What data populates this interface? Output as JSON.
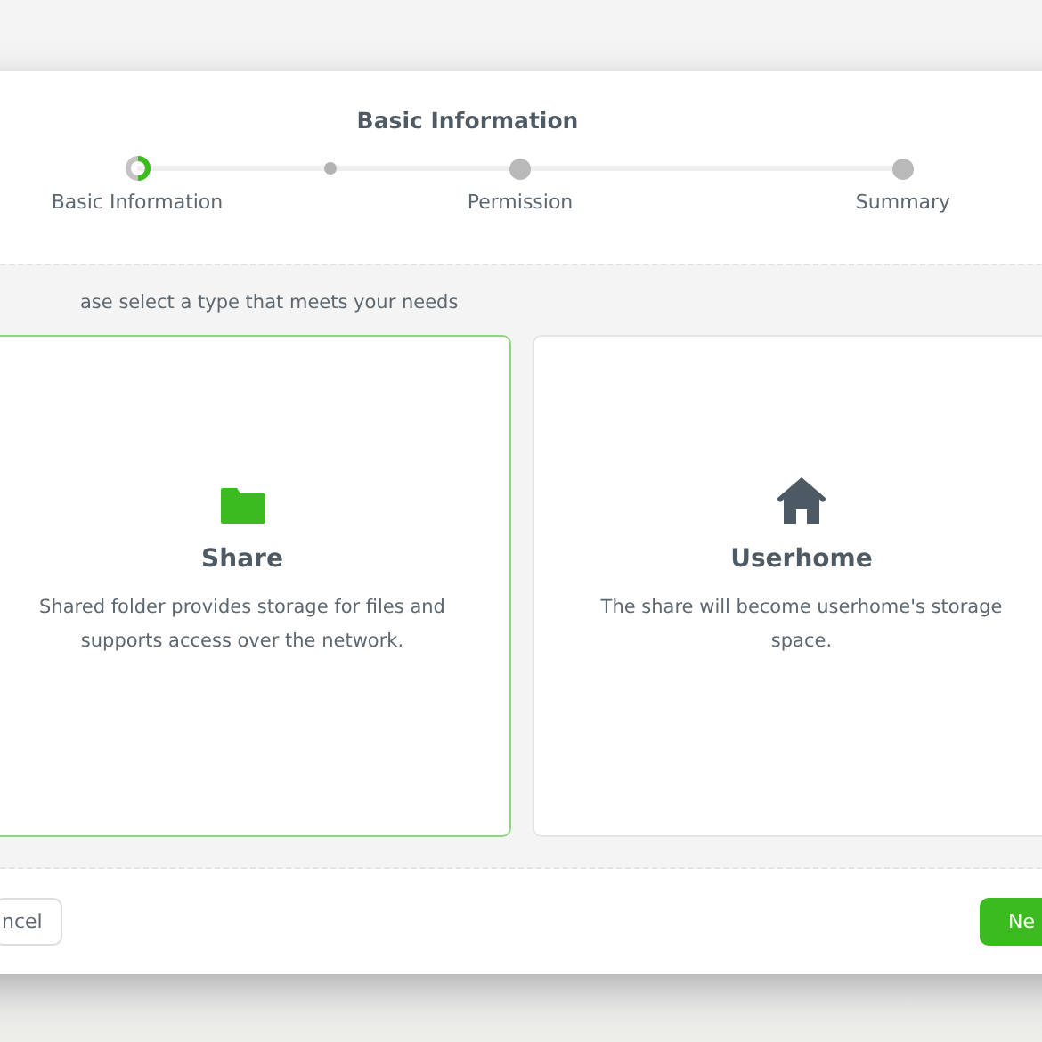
{
  "dialog": {
    "title": "Basic Information",
    "steps": [
      {
        "label": "Basic Information",
        "current": true
      },
      {
        "label": "Permission",
        "current": false
      },
      {
        "label": "Summary",
        "current": false
      }
    ],
    "instruction": "ase select a type that meets your needs",
    "options": [
      {
        "kind": "folder",
        "title": "Share",
        "description": "Shared folder provides storage for files and supports access over the network.",
        "selected": true
      },
      {
        "kind": "home",
        "title": "Userhome",
        "description": "The share will become userhome's storage space.",
        "selected": false
      }
    ],
    "buttons": [
      {
        "label": "ncel",
        "kind": "secondary"
      },
      {
        "label": "Ne",
        "kind": "primary"
      }
    ]
  }
}
